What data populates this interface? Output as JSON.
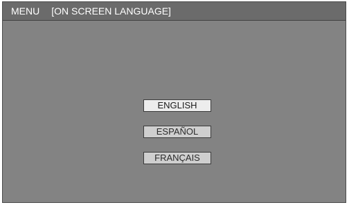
{
  "header": {
    "menu_label": "MENU",
    "screen_title": "[ON SCREEN LANGUAGE]"
  },
  "languages": [
    {
      "label": "ENGLISH",
      "selected": true
    },
    {
      "label": "ESPAÑOL",
      "selected": false
    },
    {
      "label": "FRANÇAIS",
      "selected": false
    }
  ],
  "colors": {
    "screen_background": "#838383",
    "header_background": "#6b6b6b",
    "button_background": "#cfcfcf",
    "selected_button_background": "#ededed"
  }
}
